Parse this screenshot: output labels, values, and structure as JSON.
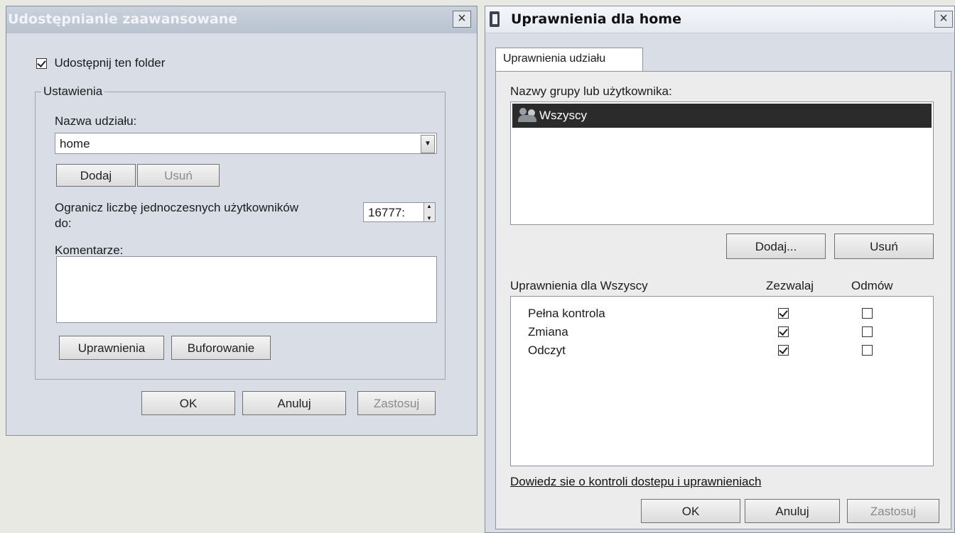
{
  "advanced_sharing": {
    "title": "Udostępnianie zaawansowane",
    "share_checkbox": {
      "label": "Udostępnij ten folder",
      "checked": true
    },
    "settings_group": "Ustawienia",
    "share_name_label": "Nazwa udziału:",
    "share_name_value": "home",
    "add_button": "Dodaj",
    "remove_button": "Usuń",
    "limit_label_line1": "Ogranicz liczbę jednoczesnych użytkowników",
    "limit_label_line2": "do:",
    "limit_value": "16777:",
    "comments_label": "Komentarze:",
    "comments_value": "",
    "permissions_button": "Uprawnienia",
    "caching_button": "Buforowanie",
    "ok_button": "OK",
    "cancel_button": "Anuluj",
    "apply_button": "Zastosuj",
    "close_glyph": "×"
  },
  "permissions_window": {
    "title": "Uprawnienia dla home",
    "tab": "Uprawnienia udziału",
    "groups_label": "Nazwy grupy lub użytkownika:",
    "groups": [
      "Wszyscy"
    ],
    "add_button": "Dodaj...",
    "remove_button": "Usuń",
    "perms_header": "Uprawnienia dla Wszyscy",
    "allow_header": "Zezwalaj",
    "deny_header": "Odmów",
    "permissions": [
      {
        "name": "Pełna kontrola",
        "allow": true,
        "deny": false
      },
      {
        "name": "Zmiana",
        "allow": true,
        "deny": false
      },
      {
        "name": "Odczyt",
        "allow": true,
        "deny": false
      }
    ],
    "help_link": "Dowiedz sie o kontroli dostepu i uprawnieniach",
    "ok_button": "OK",
    "cancel_button": "Anuluj",
    "apply_button": "Zastosuj",
    "close_glyph": "×"
  }
}
